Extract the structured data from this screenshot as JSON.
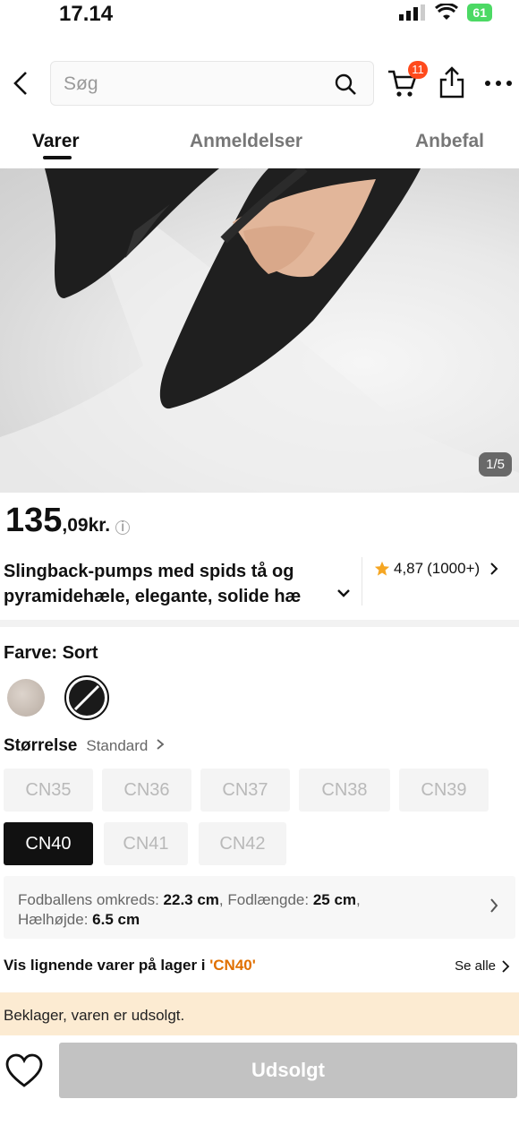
{
  "status_bar": {
    "time": "17.14",
    "battery": "61"
  },
  "search": {
    "placeholder": "Søg"
  },
  "cart": {
    "badge": "11"
  },
  "tabs": [
    {
      "label": "Varer",
      "active": true
    },
    {
      "label": "Anmeldelser",
      "active": false
    },
    {
      "label": "Anbefal",
      "active": false
    }
  ],
  "gallery": {
    "counter": "1/5"
  },
  "price": {
    "integer": "135",
    "decimal": ",09kr."
  },
  "product": {
    "title_line1": "Slingback-pumps med spids tå og",
    "title_line2": "pyramidehæle, elegante, solide hæ",
    "rating": "4,87",
    "rating_count": "(1000+)"
  },
  "color": {
    "label": "Farve: Sort",
    "options": [
      "beige",
      "black"
    ],
    "selected": "black"
  },
  "size": {
    "label": "Størrelse",
    "standard": "Standard",
    "options": [
      "CN35",
      "CN36",
      "CN37",
      "CN38",
      "CN39",
      "CN40",
      "CN41",
      "CN42"
    ],
    "selected": "CN40"
  },
  "measurements": {
    "ball_label": "Fodballens omkreds: ",
    "ball_value": "22.3 cm",
    "length_label": ", Fodlængde: ",
    "length_value": "25 cm",
    "sep": ",",
    "heel_label": "Hælhøjde: ",
    "heel_value": "6.5 cm"
  },
  "similar": {
    "prefix": "Vis lignende varer på lager i ",
    "size": "'CN40'",
    "see_all": "Se alle"
  },
  "notice": {
    "text": "Beklager, varen er udsolgt."
  },
  "action": {
    "button": "Udsolgt"
  },
  "colors": {
    "accent_badge": "#ff4a1c",
    "rating_star": "#f5a623",
    "similar_highlight": "#e07000",
    "notice_bg": "#fcebd2"
  }
}
